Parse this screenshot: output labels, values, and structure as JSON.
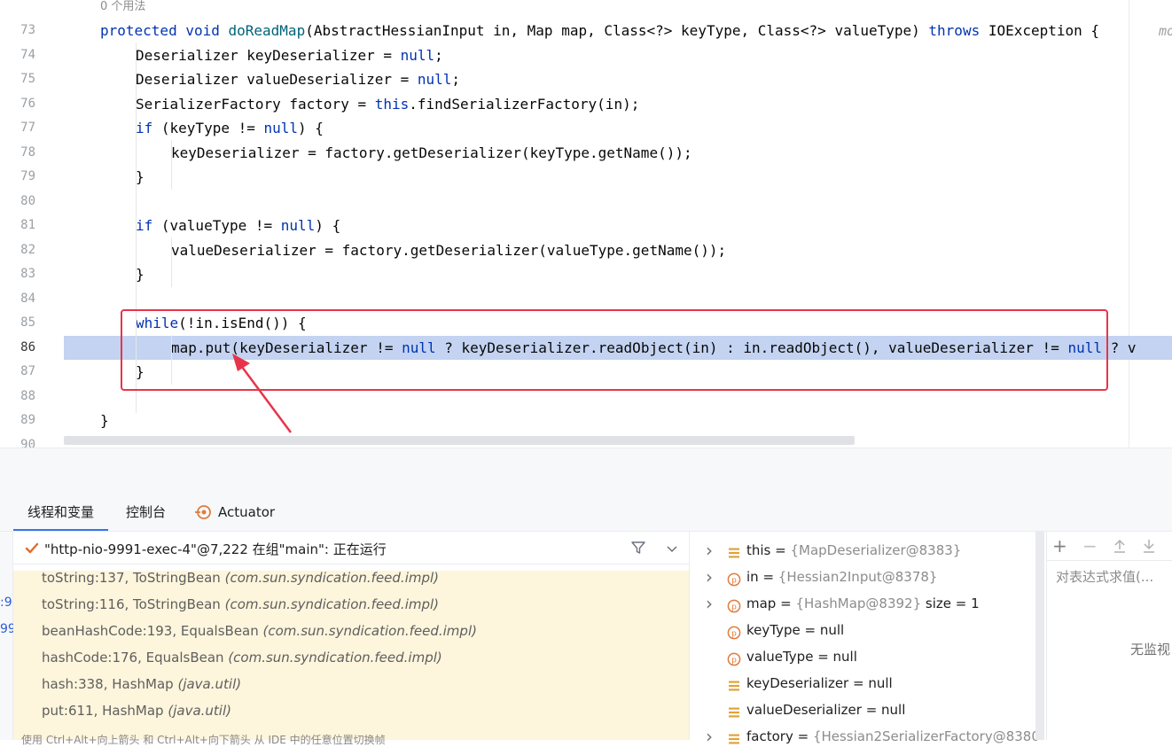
{
  "editor": {
    "usage_hint": "0 个用法",
    "right_hint": "mo",
    "lines": [
      {
        "num": "73",
        "segments": [
          [
            "kw",
            "protected void "
          ],
          [
            "fn",
            "doReadMap"
          ],
          [
            "",
            "(AbstractHessianInput in, Map map, Class<?> keyType, Class<?> valueType) "
          ],
          [
            "kw",
            "throws"
          ],
          [
            "",
            " IOException {"
          ]
        ]
      },
      {
        "num": "74",
        "segments": [
          [
            "",
            "Deserializer keyDeserializer = "
          ],
          [
            "kw",
            "null"
          ],
          [
            "",
            ";"
          ]
        ]
      },
      {
        "num": "75",
        "segments": [
          [
            "",
            "Deserializer valueDeserializer = "
          ],
          [
            "kw",
            "null"
          ],
          [
            "",
            ";"
          ]
        ]
      },
      {
        "num": "76",
        "segments": [
          [
            "",
            "SerializerFactory factory = "
          ],
          [
            "kw",
            "this"
          ],
          [
            "",
            ".findSerializerFactory(in);"
          ]
        ]
      },
      {
        "num": "77",
        "segments": [
          [
            "kw",
            "if"
          ],
          [
            "",
            " (keyType != "
          ],
          [
            "kw",
            "null"
          ],
          [
            "",
            ") {"
          ]
        ]
      },
      {
        "num": "78",
        "segments": [
          [
            "",
            "keyDeserializer = factory.getDeserializer(keyType.getName());"
          ]
        ]
      },
      {
        "num": "79",
        "segments": [
          [
            "",
            "}"
          ]
        ]
      },
      {
        "num": "80",
        "segments": []
      },
      {
        "num": "81",
        "segments": [
          [
            "kw",
            "if"
          ],
          [
            "",
            " (valueType != "
          ],
          [
            "kw",
            "null"
          ],
          [
            "",
            ") {"
          ]
        ]
      },
      {
        "num": "82",
        "segments": [
          [
            "",
            "valueDeserializer = factory.getDeserializer(valueType.getName());"
          ]
        ]
      },
      {
        "num": "83",
        "segments": [
          [
            "",
            "}"
          ]
        ]
      },
      {
        "num": "84",
        "segments": []
      },
      {
        "num": "85",
        "segments": [
          [
            "kw",
            "while"
          ],
          [
            "",
            "(!in.isEnd()) {"
          ]
        ]
      },
      {
        "num": "86",
        "segments": [
          [
            "",
            "map.put(keyDeserializer != "
          ],
          [
            "kw",
            "null"
          ],
          [
            "",
            " ? keyDeserializer.readObject(in) : in.readObject(), valueDeserializer != "
          ],
          [
            "kw",
            "null"
          ],
          [
            "",
            " ? v"
          ]
        ]
      },
      {
        "num": "87",
        "segments": [
          [
            "",
            "}"
          ]
        ]
      },
      {
        "num": "88",
        "segments": []
      },
      {
        "num": "89",
        "segments": [
          [
            "",
            "}"
          ]
        ]
      },
      {
        "num": "90",
        "segments": []
      }
    ]
  },
  "tabs": [
    {
      "label": "线程和变量"
    },
    {
      "label": "控制台"
    },
    {
      "label": "Actuator"
    }
  ],
  "thread": {
    "label": "\"http-nio-9991-exec-4\"@7,222 在组\"main\": 正在运行"
  },
  "left_strip": {
    "a": ":9",
    "b": "99"
  },
  "frames": [
    {
      "method": "toString:137, ToStringBean ",
      "pkg": "(com.sun.syndication.feed.impl)"
    },
    {
      "method": "toString:116, ToStringBean ",
      "pkg": "(com.sun.syndication.feed.impl)"
    },
    {
      "method": "beanHashCode:193, EqualsBean ",
      "pkg": "(com.sun.syndication.feed.impl)"
    },
    {
      "method": "hashCode:176, EqualsBean ",
      "pkg": "(com.sun.syndication.feed.impl)"
    },
    {
      "method": "hash:338, HashMap ",
      "pkg": "(java.util)"
    },
    {
      "method": "put:611, HashMap ",
      "pkg": "(java.util)"
    }
  ],
  "bottom_hint": "使用 Ctrl+Alt+向上箭头 和 Ctrl+Alt+向下箭头 从 IDE 中的任意位置切换帧",
  "variables": [
    {
      "name": "this",
      "eq": " = ",
      "value": "{MapDeserializer@8383}",
      "extra": "",
      "icon": "field",
      "expandable": true
    },
    {
      "name": "in",
      "eq": " = ",
      "value": "{Hessian2Input@8378}",
      "extra": "",
      "icon": "param",
      "expandable": true
    },
    {
      "name": "map",
      "eq": " = ",
      "value": "{HashMap@8392}",
      "extra": "  size = 1",
      "icon": "param",
      "expandable": true
    },
    {
      "name": "keyType",
      "eq": " = ",
      "value": "null",
      "extra": "",
      "icon": "param",
      "expandable": false
    },
    {
      "name": "valueType",
      "eq": " = ",
      "value": "null",
      "extra": "",
      "icon": "param",
      "expandable": false
    },
    {
      "name": "keyDeserializer",
      "eq": " = ",
      "value": "null",
      "extra": "",
      "icon": "field",
      "expandable": false
    },
    {
      "name": "valueDeserializer",
      "eq": " = ",
      "value": "null",
      "extra": "",
      "icon": "field",
      "expandable": false
    },
    {
      "name": "factory",
      "eq": " = ",
      "value": "{Hessian2SerializerFactory@8380",
      "extra": "",
      "icon": "field",
      "expandable": true
    }
  ],
  "watch": {
    "placeholder": "对表达式求值(...",
    "empty": "无监视"
  },
  "colors": {
    "keyword": "#0033b3",
    "method": "#00627a",
    "highlight": "#c3d3f1",
    "annotation_red": "#e8344a",
    "frame_bg": "#fdf5dc"
  }
}
